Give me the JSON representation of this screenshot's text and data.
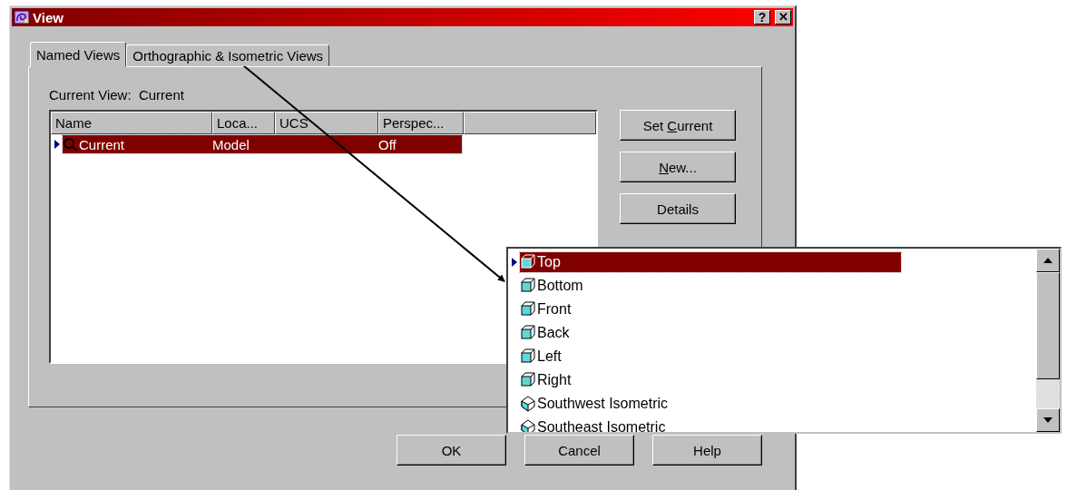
{
  "window": {
    "title": "View"
  },
  "title_buttons": [
    {
      "kind": "help",
      "label": "?"
    },
    {
      "kind": "close",
      "label": "✕"
    }
  ],
  "tabs": [
    {
      "label": "Named Views",
      "selected": true
    },
    {
      "label": "Orthographic & Isometric Views",
      "selected": false
    }
  ],
  "current_view": {
    "label": "Current View:",
    "value": "Current"
  },
  "table": {
    "columns": [
      "Name",
      "Loca...",
      "UCS",
      "Perspec..."
    ],
    "rows": [
      {
        "cells": [
          "Current",
          "Model",
          "",
          "Off"
        ],
        "selected": true
      }
    ]
  },
  "side_buttons": [
    {
      "pre": "Set ",
      "key": "C",
      "post": "urrent"
    },
    {
      "key": "N",
      "post": "ew..."
    },
    {
      "post": "Details"
    }
  ],
  "footer_buttons": [
    "OK",
    "Cancel",
    "Help"
  ],
  "popup_list": {
    "items": [
      {
        "label": "Top",
        "kind": "orthographic",
        "selected": true
      },
      {
        "label": "Bottom",
        "kind": "orthographic",
        "selected": false
      },
      {
        "label": "Front",
        "kind": "orthographic",
        "selected": false
      },
      {
        "label": "Back",
        "kind": "orthographic",
        "selected": false
      },
      {
        "label": "Left",
        "kind": "orthographic",
        "selected": false
      },
      {
        "label": "Right",
        "kind": "orthographic",
        "selected": false
      },
      {
        "label": "Southwest Isometric",
        "kind": "isometric",
        "selected": false
      },
      {
        "label": "Southeast Isometric",
        "kind": "isometric",
        "selected": false
      }
    ]
  }
}
